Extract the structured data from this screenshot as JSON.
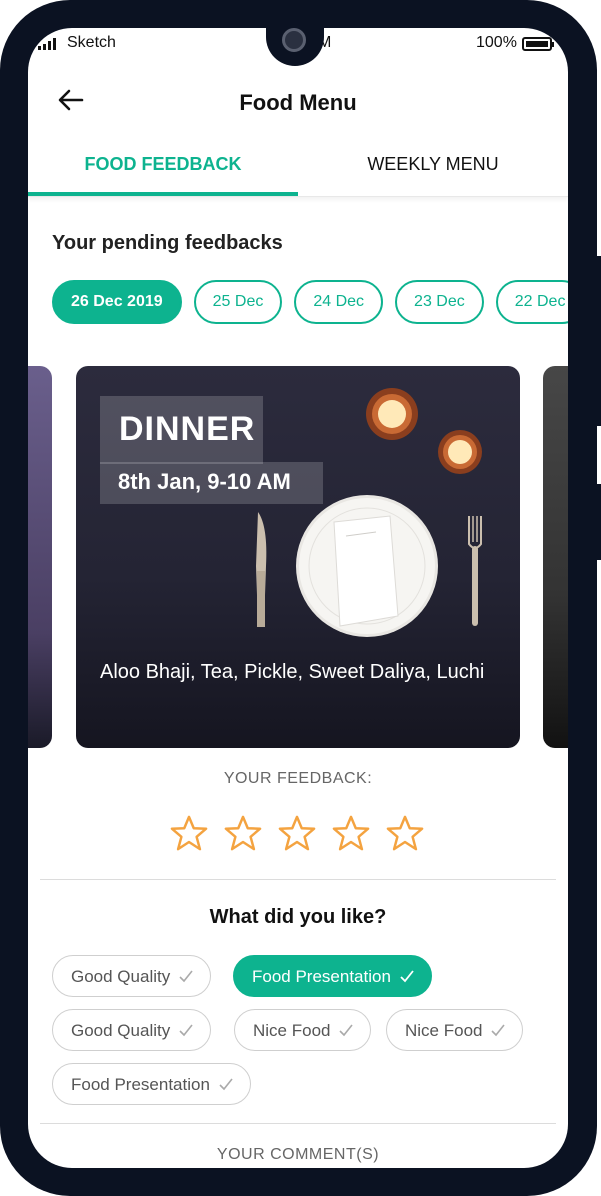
{
  "status_bar": {
    "carrier": "Sketch",
    "time_fragment": "M",
    "battery": "100%"
  },
  "header": {
    "title": "Food Menu",
    "back_icon": "arrow-left-icon"
  },
  "tabs": [
    {
      "label": "FOOD FEEDBACK",
      "active": true
    },
    {
      "label": "WEEKLY MENU",
      "active": false
    }
  ],
  "pending": {
    "title": "Your pending feedbacks",
    "dates": [
      {
        "label": "26 Dec 2019",
        "active": true
      },
      {
        "label": "25 Dec",
        "active": false
      },
      {
        "label": "24 Dec",
        "active": false
      },
      {
        "label": "23 Dec",
        "active": false
      },
      {
        "label": "22 Dec",
        "active": false
      }
    ]
  },
  "meal_card": {
    "meal": "DINNER",
    "date_time": "8th Jan, 9-10 AM",
    "menu": "Aloo Bhaji, Tea, Pickle, Sweet Daliya, Luchi"
  },
  "feedback": {
    "label": "YOUR FEEDBACK:",
    "stars_total": 5,
    "rating": 0,
    "star_color": "#f4a340"
  },
  "likes": {
    "title": "What did you like?",
    "tags": [
      {
        "label": "Good Quality",
        "selected": false
      },
      {
        "label": "Food Presentation",
        "selected": true
      },
      {
        "label": "Good Quality",
        "selected": false
      },
      {
        "label": "Nice Food",
        "selected": false
      },
      {
        "label": "Nice Food",
        "selected": false
      },
      {
        "label": "Food Presentation",
        "selected": false
      }
    ]
  },
  "comments": {
    "label": "YOUR COMMENT(S)"
  },
  "colors": {
    "accent": "#0db38f",
    "frame": "#0b1222"
  }
}
